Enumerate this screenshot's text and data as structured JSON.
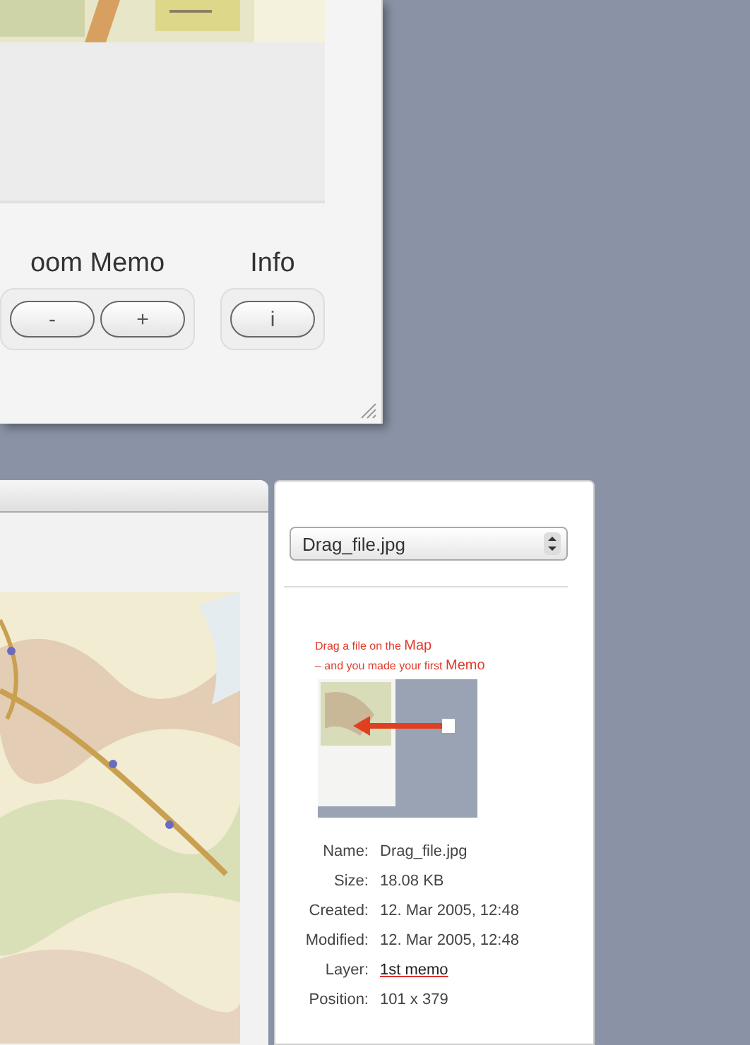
{
  "top_window": {
    "groups": [
      {
        "label": "oom Memo",
        "buttons": [
          "-",
          "+"
        ]
      },
      {
        "label": "Info",
        "buttons": [
          "i"
        ]
      }
    ]
  },
  "bottom_window": {
    "file_select": {
      "value": "Drag_file.jpg"
    },
    "hint": [
      "Drag a file on the **Map**",
      "– and you made your first **Memo**"
    ],
    "fields": [
      {
        "label": "Name:",
        "value": "Drag_file.jpg",
        "kind": "text"
      },
      {
        "label": "Size:",
        "value": "18.08 KB",
        "kind": "text"
      },
      {
        "label": "Created:",
        "value": "12. Mar 2005, 12:48",
        "kind": "text"
      },
      {
        "label": "Modified:",
        "value": "12. Mar 2005, 12:48",
        "kind": "text"
      },
      {
        "label": "Layer:",
        "value": "1st memo",
        "kind": "link"
      },
      {
        "label": "Position:",
        "value": "101 x  379",
        "kind": "text"
      }
    ]
  }
}
